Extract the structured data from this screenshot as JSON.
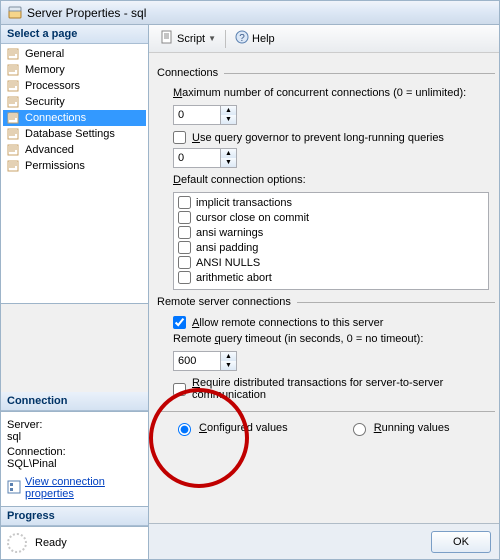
{
  "title": "Server Properties - sql",
  "toolbar": {
    "script": "Script",
    "help": "Help"
  },
  "left": {
    "select_page": "Select a page",
    "pages": [
      "General",
      "Memory",
      "Processors",
      "Security",
      "Connections",
      "Database Settings",
      "Advanced",
      "Permissions"
    ],
    "selected_index": 4,
    "connection_header": "Connection",
    "server_label": "Server:",
    "server_value": "sql",
    "connection_label": "Connection:",
    "connection_value": "SQL\\Pinal",
    "view_props": "View connection properties",
    "progress_header": "Progress",
    "progress_status": "Ready"
  },
  "conn": {
    "group": "Connections",
    "max_label_pre": "M",
    "max_label_post": "aximum number of concurrent connections (0 = unlimited):",
    "max_value": "0",
    "governor_pre": "U",
    "governor_post": "se query governor to prevent long-running queries",
    "governor_value": "0",
    "default_opts_pre": "D",
    "default_opts_post": "efault connection options:",
    "options": [
      "implicit transactions",
      "cursor close on commit",
      "ansi warnings",
      "ansi padding",
      "ANSI NULLS",
      "arithmetic abort"
    ]
  },
  "remote": {
    "group": "Remote server connections",
    "allow_pre": "A",
    "allow_post": "llow remote connections to this server",
    "allow_checked": true,
    "timeout_pre": "Remote ",
    "timeout_u": "q",
    "timeout_post": "uery timeout (in seconds, 0 = no timeout):",
    "timeout_value": "600",
    "dist_pre": "R",
    "dist_post": "equire distributed transactions for server-to-server communication"
  },
  "footer": {
    "configured_pre": "C",
    "configured_post": "onfigured values",
    "running_pre": "R",
    "running_post": "unning values",
    "ok": "OK"
  }
}
